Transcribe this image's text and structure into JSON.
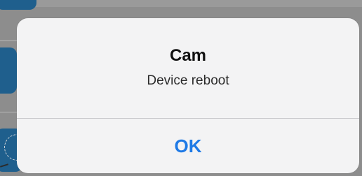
{
  "alert": {
    "title": "Cam",
    "message": "Device reboot",
    "ok_label": "OK"
  },
  "colors": {
    "button_tint": "#1f7ae6",
    "dialog_background": "#f3f3f4",
    "dimmed_background": "#8d8d8d"
  }
}
